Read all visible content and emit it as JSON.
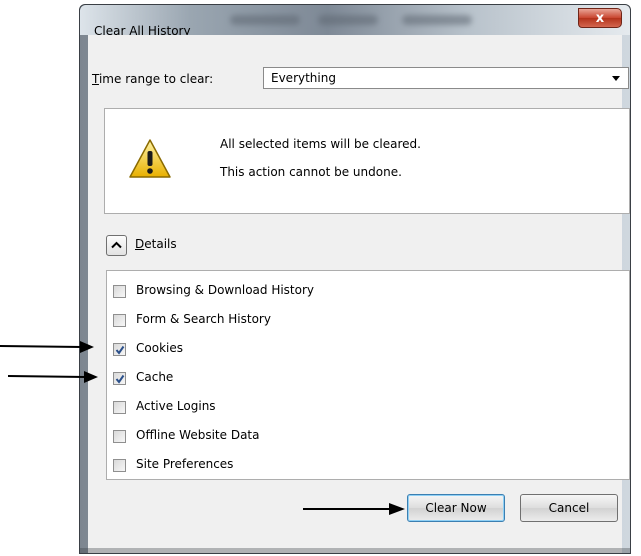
{
  "window": {
    "title": "Clear All History",
    "close_glyph": "x"
  },
  "time_range": {
    "label_prefix": "T",
    "label_rest": "ime range to clear:",
    "selected": "Everything"
  },
  "warning": {
    "line1": "All selected items will be cleared.",
    "line2": "This action cannot be undone."
  },
  "details": {
    "label_prefix": "D",
    "label_rest": "etails",
    "expanded": true
  },
  "items": [
    {
      "label": "Browsing & Download History",
      "checked": false
    },
    {
      "label": "Form & Search History",
      "checked": false
    },
    {
      "label": "Cookies",
      "checked": true
    },
    {
      "label": "Cache",
      "checked": true
    },
    {
      "label": "Active Logins",
      "checked": false
    },
    {
      "label": "Offline Website Data",
      "checked": false
    },
    {
      "label": "Site Preferences",
      "checked": false
    }
  ],
  "buttons": {
    "clear_now": "Clear Now",
    "cancel": "Cancel"
  },
  "icons": {
    "warning": "warning-triangle-icon",
    "collapse": "chevron-up-icon",
    "dropdown": "chevron-down-icon",
    "check": "checkmark-icon",
    "annotation": "arrow-right-icon"
  },
  "colors": {
    "check_blue": "#2a4f8a",
    "warning_yellow": "#f5c518"
  }
}
